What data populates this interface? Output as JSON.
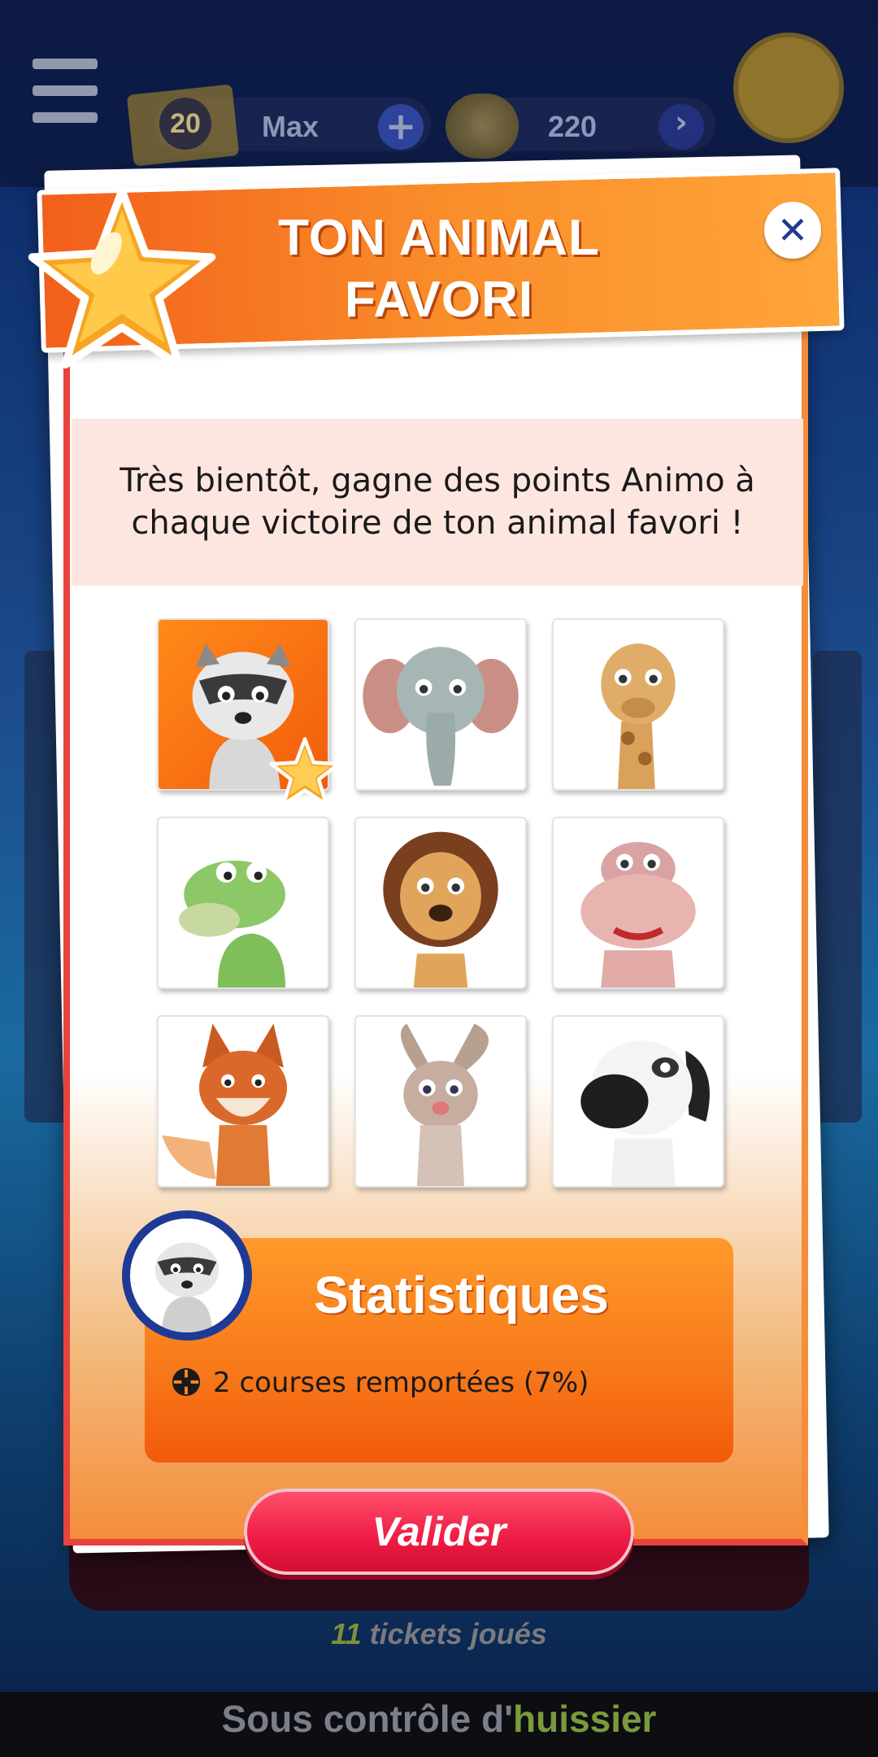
{
  "top_bar": {
    "tickets": "20",
    "max_label": "Max",
    "plus_icon": "plus-icon",
    "coins_icon": "coins-icon",
    "coins": "220",
    "next_icon": "chevron-right-icon",
    "menu_icon": "hamburger-menu-icon"
  },
  "modal": {
    "title_line1": "TON ANIMAL",
    "title_line2": "FAVORI",
    "close_icon": "close-icon",
    "info_line1": "Très bientôt, gagne des points Animo à",
    "info_line2": "chaque victoire de ton animal favori !"
  },
  "animals": [
    {
      "name": "raccoon",
      "selected": true
    },
    {
      "name": "elephant",
      "selected": false
    },
    {
      "name": "giraffe",
      "selected": false
    },
    {
      "name": "crocodile",
      "selected": false
    },
    {
      "name": "lion",
      "selected": false
    },
    {
      "name": "hippo",
      "selected": false
    },
    {
      "name": "fox",
      "selected": false
    },
    {
      "name": "rabbit",
      "selected": false
    },
    {
      "name": "dog",
      "selected": false
    }
  ],
  "stats": {
    "title": "Statistiques",
    "line": "2 courses remportées (7%)"
  },
  "buttons": {
    "validate": "Valider"
  },
  "background": {
    "tickets_played_num": "11",
    "tickets_played_text": " tickets joués",
    "footer_text": "Sous contrôle d'",
    "footer_highlight": "huissier"
  },
  "colors": {
    "header_orange": "#f98d2a",
    "accent_red": "#ee1b44",
    "info_bg": "#fde6e0",
    "close_blue": "#1e3b8f"
  }
}
